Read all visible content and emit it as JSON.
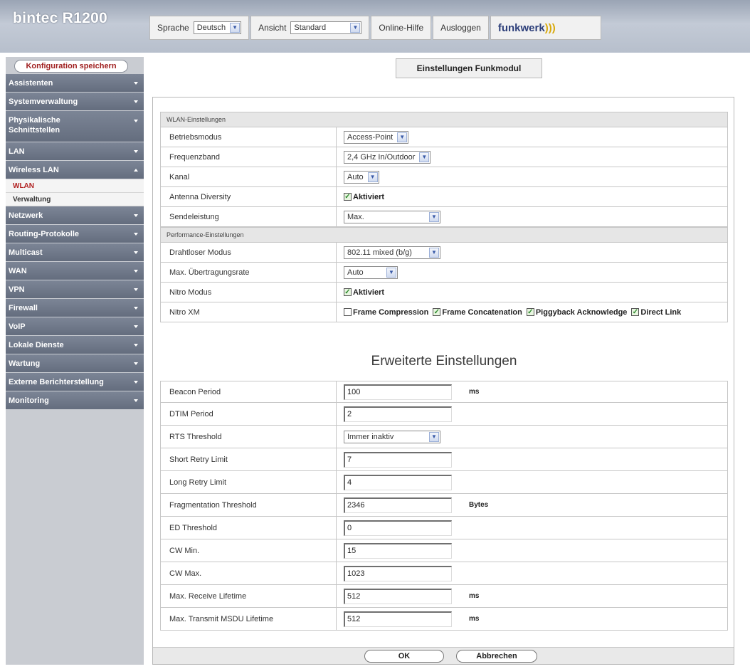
{
  "header": {
    "brand": "bintec",
    "model": "R1200",
    "language_label": "Sprache",
    "language_value": "Deutsch",
    "view_label": "Ansicht",
    "view_value": "Standard",
    "help": "Online-Hilfe",
    "logout": "Ausloggen",
    "logo": "funkwerk",
    "logo_swirl": ")))"
  },
  "sidebar": {
    "save": "Konfiguration speichern",
    "items": [
      {
        "label": "Assistenten"
      },
      {
        "label": "Systemverwaltung"
      },
      {
        "label": "Physikalische Schnittstellen"
      },
      {
        "label": "LAN"
      },
      {
        "label": "Wireless LAN",
        "subs": [
          "WLAN",
          "Verwaltung"
        ]
      },
      {
        "label": "Netzwerk"
      },
      {
        "label": "Routing-Protokolle"
      },
      {
        "label": "Multicast"
      },
      {
        "label": "WAN"
      },
      {
        "label": "VPN"
      },
      {
        "label": "Firewall"
      },
      {
        "label": "VoIP"
      },
      {
        "label": "Lokale Dienste"
      },
      {
        "label": "Wartung"
      },
      {
        "label": "Externe Berichterstellung"
      },
      {
        "label": "Monitoring"
      }
    ]
  },
  "page_title": "Einstellungen Funkmodul",
  "wlan": {
    "section": "WLAN-Einstellungen",
    "betriebsmodus": {
      "label": "Betriebsmodus",
      "value": "Access-Point"
    },
    "frequenzband": {
      "label": "Frequenzband",
      "value": "2,4 GHz In/Outdoor"
    },
    "kanal": {
      "label": "Kanal",
      "value": "Auto"
    },
    "antenna": {
      "label": "Antenna Diversity",
      "value": "Aktiviert",
      "checked": true
    },
    "sendeleistung": {
      "label": "Sendeleistung",
      "value": "Max."
    }
  },
  "performance": {
    "section": "Performance-Einstellungen",
    "drahtlos": {
      "label": "Drahtloser Modus",
      "value": "802.11 mixed (b/g)"
    },
    "rate": {
      "label": "Max. Übertragungsrate",
      "value": "Auto"
    },
    "nitro": {
      "label": "Nitro Modus",
      "value": "Aktiviert",
      "checked": true
    },
    "nitro_xm": {
      "label": "Nitro XM",
      "options": [
        {
          "label": "Frame Compression",
          "checked": false
        },
        {
          "label": "Frame Concatenation",
          "checked": true
        },
        {
          "label": "Piggyback Acknowledge",
          "checked": true
        },
        {
          "label": "Direct Link",
          "checked": true
        }
      ]
    }
  },
  "advanced": {
    "title": "Erweiterte Einstellungen",
    "beacon": {
      "label": "Beacon Period",
      "value": "100",
      "unit": "ms"
    },
    "dtim": {
      "label": "DTIM Period",
      "value": "2"
    },
    "rts": {
      "label": "RTS Threshold",
      "value": "Immer inaktiv"
    },
    "short_retry": {
      "label": "Short Retry Limit",
      "value": "7"
    },
    "long_retry": {
      "label": "Long Retry Limit",
      "value": "4"
    },
    "frag": {
      "label": "Fragmentation Threshold",
      "value": "2346",
      "unit": "Bytes"
    },
    "ed": {
      "label": "ED Threshold",
      "value": "0"
    },
    "cwmin": {
      "label": "CW Min.",
      "value": "15"
    },
    "cwmax": {
      "label": "CW Max.",
      "value": "1023"
    },
    "rx_life": {
      "label": "Max. Receive Lifetime",
      "value": "512",
      "unit": "ms"
    },
    "tx_life": {
      "label": "Max. Transmit MSDU Lifetime",
      "value": "512",
      "unit": "ms"
    }
  },
  "buttons": {
    "ok": "OK",
    "cancel": "Abbrechen"
  },
  "colors": {
    "menu": "#6e7788",
    "accent_red": "#b01e1e",
    "check_green": "#2f8a2f"
  }
}
